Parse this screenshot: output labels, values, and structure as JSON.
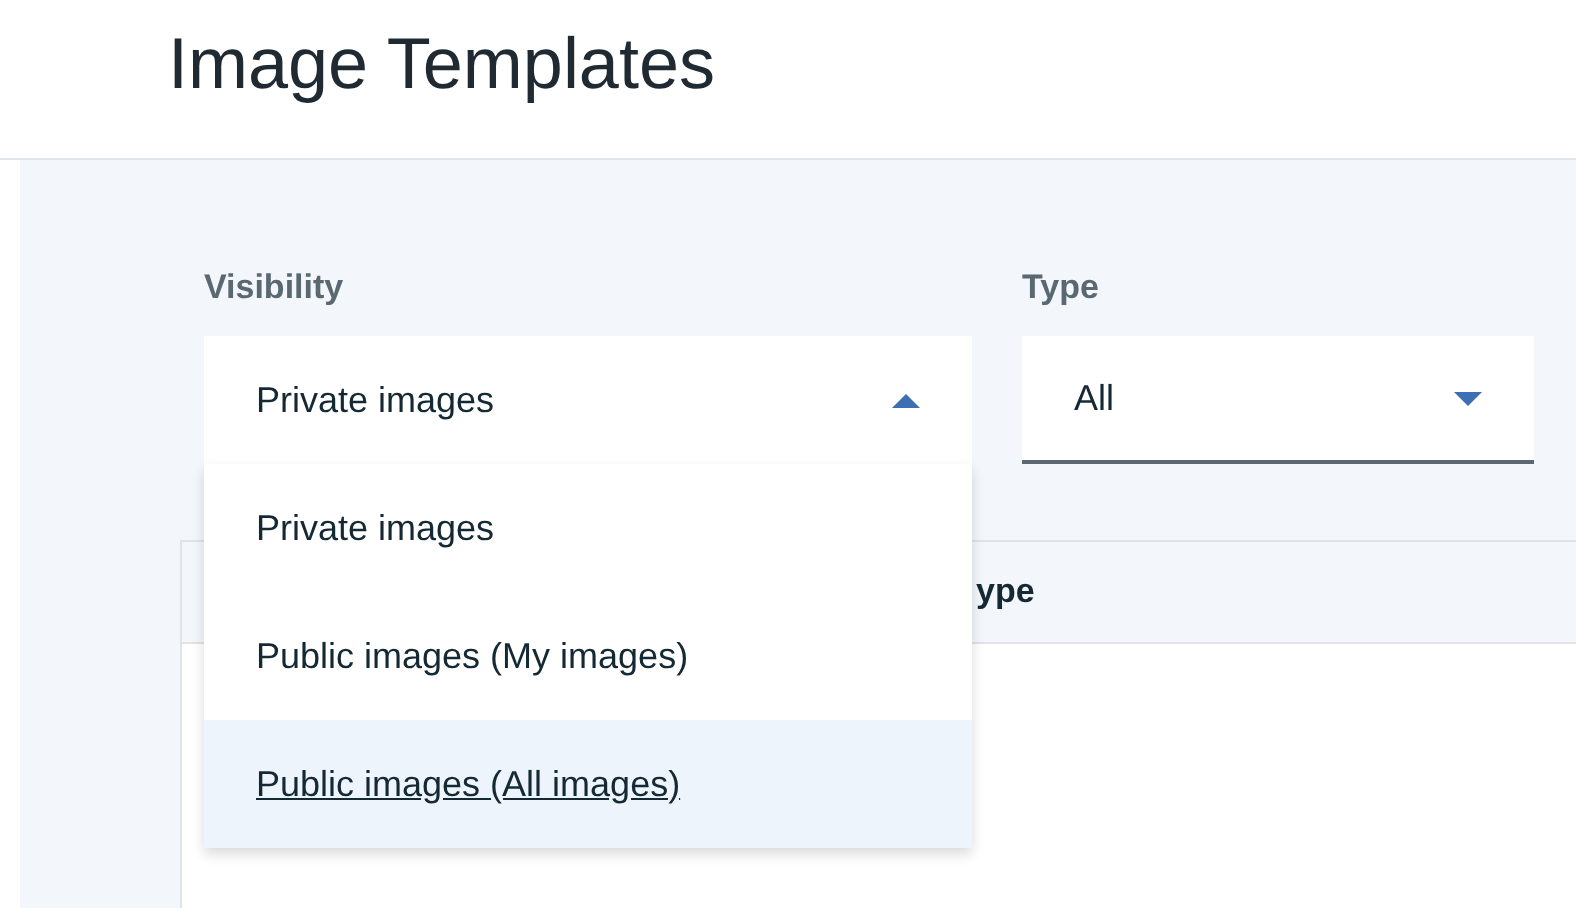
{
  "page": {
    "title": "Image Templates"
  },
  "filters": [
    {
      "label": "Visibility",
      "value": "Private images",
      "expanded": true,
      "options": [
        {
          "label": "Private images",
          "highlighted": false
        },
        {
          "label": "Public images (My images)",
          "highlighted": false
        },
        {
          "label": "Public images (All images)",
          "highlighted": true
        }
      ]
    },
    {
      "label": "Type",
      "value": "All",
      "expanded": false
    }
  ],
  "table": {
    "columns": [
      "ype"
    ]
  }
}
